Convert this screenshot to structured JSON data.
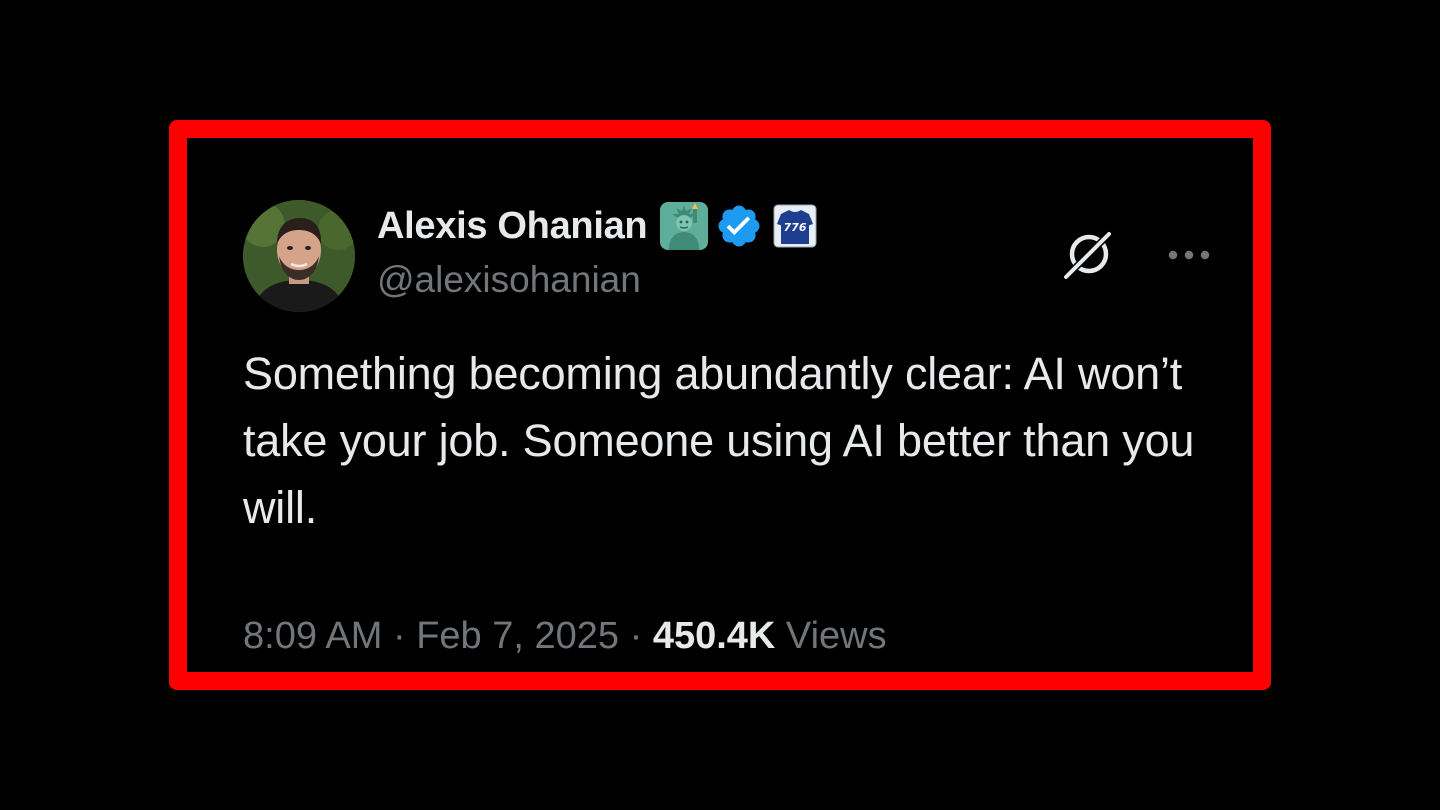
{
  "tweet": {
    "author_name": "Alexis Ohanian",
    "handle": "@alexisohanian",
    "badges": [
      "statue-of-liberty-emoji",
      "verified-badge-icon",
      "jersey-776-emoji"
    ],
    "jersey_number": "776",
    "text": "Something becoming abundantly clear: AI won’t take your job. Someone using AI better than you will.",
    "time": "8:09 AM",
    "separator": "·",
    "date": "Feb 7, 2025",
    "views_count": "450.4K",
    "views_label": "Views"
  },
  "colors": {
    "background": "#000000",
    "highlight_border": "#ff0000",
    "primary_text": "#e7e9ea",
    "secondary_text": "#71767b",
    "verified_blue": "#1d9bf0"
  },
  "icons": {
    "grok": "grok-icon",
    "more": "more-options-icon"
  }
}
